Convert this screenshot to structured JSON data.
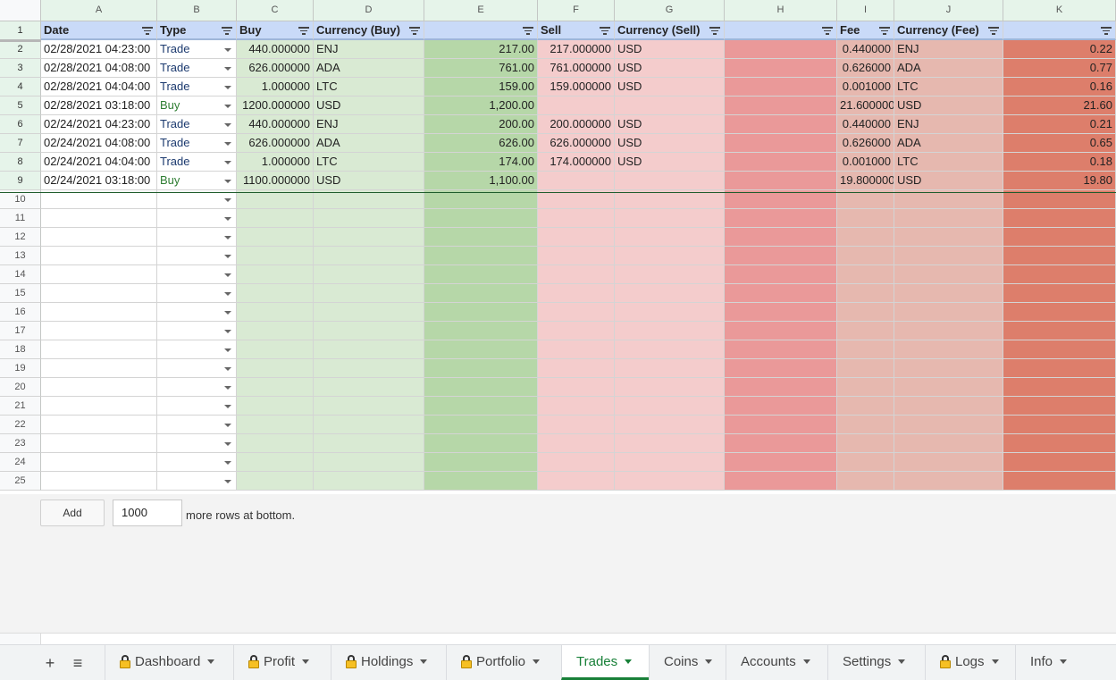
{
  "columns": [
    "A",
    "B",
    "C",
    "D",
    "E",
    "F",
    "G",
    "H",
    "I",
    "J",
    "K"
  ],
  "headers": [
    "Date",
    "Type",
    "Buy",
    "Currency (Buy)",
    "",
    "Sell",
    "Currency (Sell)",
    "",
    "Fee",
    "Currency (Fee)",
    ""
  ],
  "rows": [
    {
      "date": "02/28/2021 04:23:00",
      "type": "Trade",
      "buy": "440.000000",
      "cur_buy": "ENJ",
      "e": "217.00",
      "sell": "217.000000",
      "cur_sell": "USD",
      "fee": "0.440000",
      "cur_fee": "ENJ",
      "k": "0.22"
    },
    {
      "date": "02/28/2021 04:08:00",
      "type": "Trade",
      "buy": "626.000000",
      "cur_buy": "ADA",
      "e": "761.00",
      "sell": "761.000000",
      "cur_sell": "USD",
      "fee": "0.626000",
      "cur_fee": "ADA",
      "k": "0.77"
    },
    {
      "date": "02/28/2021 04:04:00",
      "type": "Trade",
      "buy": "1.000000",
      "cur_buy": "LTC",
      "e": "159.00",
      "sell": "159.000000",
      "cur_sell": "USD",
      "fee": "0.001000",
      "cur_fee": "LTC",
      "k": "0.16"
    },
    {
      "date": "02/28/2021 03:18:00",
      "type": "Buy",
      "buy": "1200.000000",
      "cur_buy": "USD",
      "e": "1,200.00",
      "sell": "",
      "cur_sell": "",
      "fee": "21.600000",
      "cur_fee": "USD",
      "k": "21.60"
    },
    {
      "date": "02/24/2021 04:23:00",
      "type": "Trade",
      "buy": "440.000000",
      "cur_buy": "ENJ",
      "e": "200.00",
      "sell": "200.000000",
      "cur_sell": "USD",
      "fee": "0.440000",
      "cur_fee": "ENJ",
      "k": "0.21"
    },
    {
      "date": "02/24/2021 04:08:00",
      "type": "Trade",
      "buy": "626.000000",
      "cur_buy": "ADA",
      "e": "626.00",
      "sell": "626.000000",
      "cur_sell": "USD",
      "fee": "0.626000",
      "cur_fee": "ADA",
      "k": "0.65"
    },
    {
      "date": "02/24/2021 04:04:00",
      "type": "Trade",
      "buy": "1.000000",
      "cur_buy": "LTC",
      "e": "174.00",
      "sell": "174.000000",
      "cur_sell": "USD",
      "fee": "0.001000",
      "cur_fee": "LTC",
      "k": "0.18"
    },
    {
      "date": "02/24/2021 03:18:00",
      "type": "Buy",
      "buy": "1100.000000",
      "cur_buy": "USD",
      "e": "1,100.00",
      "sell": "",
      "cur_sell": "",
      "fee": "19.800000",
      "cur_fee": "USD",
      "k": "19.80"
    }
  ],
  "row_numbers": [
    "1",
    "2",
    "3",
    "4",
    "5",
    "6",
    "7",
    "8",
    "9",
    "10",
    "11",
    "12",
    "13",
    "14",
    "15",
    "16",
    "17",
    "18",
    "19",
    "20",
    "21",
    "22",
    "23",
    "24",
    "25"
  ],
  "add_rows": {
    "button": "Add",
    "count": "1000",
    "suffix": "more rows at bottom."
  },
  "tabs": [
    {
      "label": "Dashboard",
      "locked": true,
      "active": false
    },
    {
      "label": "Profit",
      "locked": true,
      "active": false
    },
    {
      "label": "Holdings",
      "locked": true,
      "active": false
    },
    {
      "label": "Portfolio",
      "locked": true,
      "active": false
    },
    {
      "label": "Trades",
      "locked": false,
      "active": true
    },
    {
      "label": "Coins",
      "locked": false,
      "active": false
    },
    {
      "label": "Accounts",
      "locked": false,
      "active": false
    },
    {
      "label": "Settings",
      "locked": false,
      "active": false
    },
    {
      "label": "Logs",
      "locked": true,
      "active": false
    },
    {
      "label": "Info",
      "locked": false,
      "active": false
    }
  ],
  "icons": {
    "add_sheet": "plus-icon",
    "all_sheets": "list-icon",
    "filter": "filter-icon",
    "dropdown": "dropdown-arrow-icon",
    "lock": "lock-icon"
  },
  "colors": {
    "header_blue": "#c9daf8",
    "light_green": "#d9ead3",
    "mid_green": "#b6d7a8",
    "light_pink": "#f4cccc",
    "rose": "#ea9999",
    "dusty_pink": "#e6b8af",
    "salmon": "#dd7e6b",
    "active_tab": "#188038"
  }
}
